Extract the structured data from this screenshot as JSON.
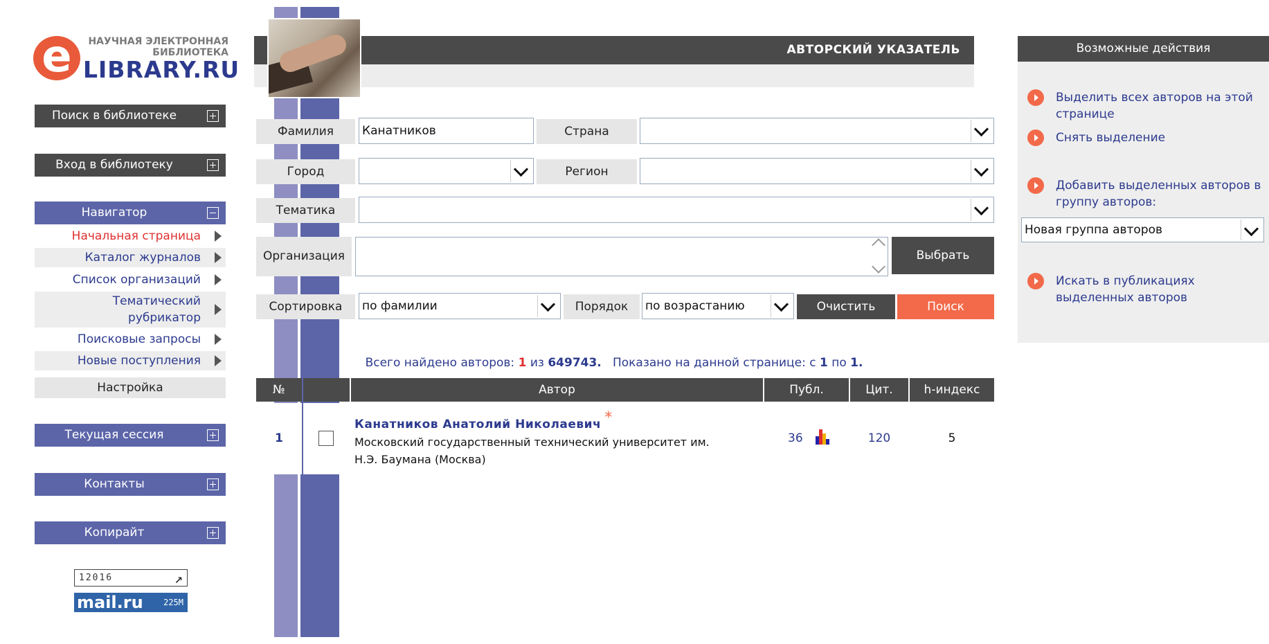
{
  "logo": {
    "line1": "НАУЧНАЯ ЭЛЕКТРОННАЯ",
    "line2": "БИБЛИОТЕКА",
    "line3": "LIBRARY.RU",
    "letter": "e"
  },
  "sidebar": {
    "search": "Поиск в библиотеке",
    "login": "Вход в библиотеку",
    "navigator": "Навигатор",
    "nav_items": [
      {
        "label": "Начальная страница"
      },
      {
        "label": "Каталог журналов"
      },
      {
        "label": "Список организаций"
      },
      {
        "label_line1": "Тематический",
        "label_line2": "рубрикатор"
      },
      {
        "label": "Поисковые запросы"
      },
      {
        "label": "Новые поступления"
      }
    ],
    "settings": "Настройка",
    "session": "Текущая сессия",
    "contacts": "Контакты",
    "copyright": "Копирайт"
  },
  "counters": {
    "liveinternet": "12016",
    "mail_logo": "mail.ru",
    "mail_count": "225M"
  },
  "header": {
    "title": "АВТОРСКИЙ УКАЗАТЕЛЬ"
  },
  "form": {
    "surname_label": "Фамилия",
    "surname_value": "Канатников",
    "country_label": "Страна",
    "country_value": "",
    "city_label": "Город",
    "city_value": "",
    "region_label": "Регион",
    "region_value": "",
    "topic_label": "Тематика",
    "topic_value": "",
    "org_label": "Организация",
    "org_value": "",
    "choose_button": "Выбрать",
    "sort_label": "Сортировка",
    "sort_value": "по фамилии",
    "order_label": "Порядок",
    "order_value": "по возрастанию",
    "clear_button": "Очистить",
    "search_button": "Поиск"
  },
  "results": {
    "found_prefix": "Всего найдено авторов:",
    "found_count": "1",
    "of_word": "из",
    "total": "649743.",
    "shown_prefix": "Показано на данной странице: с",
    "shown_from": "1",
    "shown_to_word": "по",
    "shown_to": "1.",
    "columns": [
      "№",
      "",
      "Автор",
      "Публ.",
      "Цит.",
      "h-индекс"
    ],
    "rows": [
      {
        "num": "1",
        "author": "Канатников Анатолий Николаевич",
        "asterisk": "*",
        "affil_line1": "Московский государственный технический университет им.",
        "affil_line2": "Н.Э. Баумана (Москва)",
        "publications": "36",
        "citations": "120",
        "h_index": "5"
      }
    ]
  },
  "actions": {
    "title": "Возможные действия",
    "select_all_line1": "Выделить всех авторов на этой",
    "select_all_line2": "странице",
    "deselect": "Снять выделение",
    "add_group_line1": "Добавить выделенных авторов в",
    "add_group_line2": "группу авторов:",
    "group_select_value": "Новая группа авторов",
    "search_pubs_line1": "Искать в публикациях",
    "search_pubs_line2": "выделенных авторов"
  },
  "colors": {
    "accent_blue": "#5c65a8",
    "dark_gray": "#4a4a4a",
    "orange": "#f26a4a",
    "link": "#2c3a8e"
  }
}
